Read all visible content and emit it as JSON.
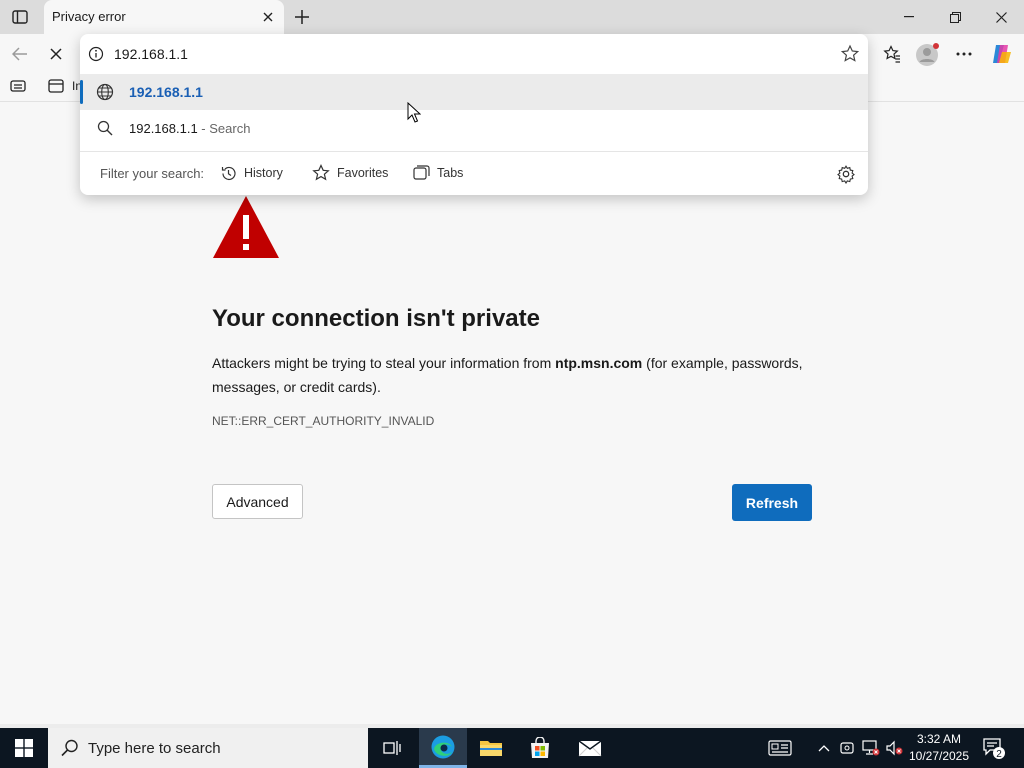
{
  "window": {
    "tab_title": "Privacy error"
  },
  "favorites_bar": {
    "item_label": "In"
  },
  "omnibox": {
    "value": "192.168.1.1",
    "suggestions": [
      {
        "text": "192.168.1.1",
        "icon": "globe-icon"
      },
      {
        "text": "192.168.1.1",
        "suffix": " - Search",
        "icon": "search-icon"
      }
    ],
    "filter_label": "Filter your search:",
    "filters": [
      "History",
      "Favorites",
      "Tabs"
    ]
  },
  "page": {
    "title": "Your connection isn't private",
    "body_pre": "Attackers might be trying to steal your information from ",
    "body_domain": "ntp.msn.com",
    "body_post": " (for example, passwords, messages, or credit cards).",
    "error_code": "NET::ERR_CERT_AUTHORITY_INVALID",
    "advanced_label": "Advanced",
    "refresh_label": "Refresh"
  },
  "taskbar": {
    "search_placeholder": "Type here to search",
    "time": "3:32 AM",
    "date": "10/27/2025",
    "notification_count": "2"
  },
  "colors": {
    "accent": "#0f6cbd",
    "warning": "#c00000",
    "taskbar": "#0c1621"
  }
}
